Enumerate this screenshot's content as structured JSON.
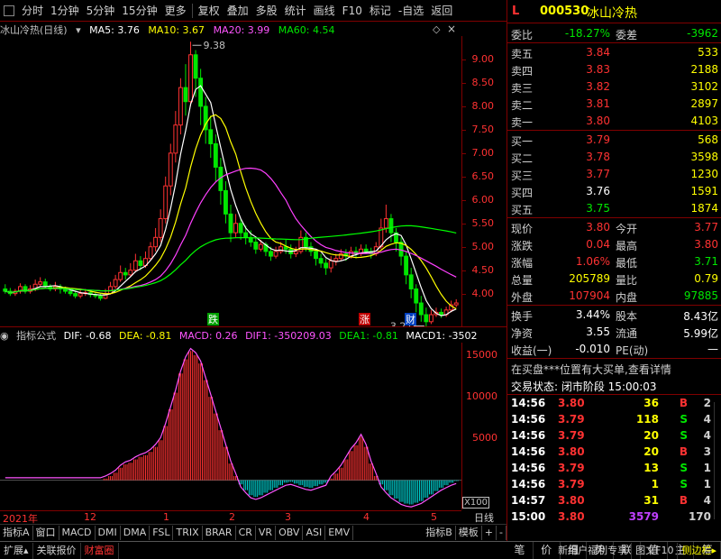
{
  "toolbar": {
    "items": [
      "分时",
      "1分钟",
      "5分钟",
      "15分钟",
      "更多",
      "复权",
      "叠加",
      "多股",
      "统计",
      "画线",
      "F10",
      "标记",
      "-自选",
      "返回"
    ]
  },
  "kline": {
    "title": "冰山冷热(日线)",
    "ma5": "MA5: 3.76",
    "ma10": "MA10: 3.67",
    "ma20": "MA20: 3.99",
    "ma60": "MA60: 4.54",
    "high_mark": "9.38",
    "low_mark": "3.27",
    "badges": [
      "跌",
      "涨",
      "财"
    ]
  },
  "macd": {
    "title": "指标公式",
    "dif": "DIF: -0.68",
    "dea": "DEA: -0.81",
    "macd": "MACD: 0.26",
    "dif1": "DIF1: -350209.03",
    "dea1": "DEA1: -0.81",
    "macd1": "MACD1: -3502",
    "scale_label": "X100"
  },
  "yaxis_main": [
    "9.00",
    "8.50",
    "8.00",
    "7.50",
    "7.00",
    "6.50",
    "6.00",
    "5.50",
    "5.00",
    "4.50",
    "4.00"
  ],
  "yaxis_macd": [
    "15000",
    "10000",
    "5000"
  ],
  "time_axis": [
    "2021年",
    "12",
    "1",
    "2",
    "3",
    "4",
    "5"
  ],
  "period": "日线",
  "indicator_tabs": [
    "指标A",
    "窗口",
    "MACD",
    "DMI",
    "DMA",
    "FSL",
    "TRIX",
    "BRAR",
    "CR",
    "VR",
    "OBV",
    "ASI",
    "EMV",
    "",
    "指标B",
    "模板",
    "+",
    "-"
  ],
  "statusbar": {
    "left": [
      "扩展",
      "关联报价",
      "财富圈"
    ],
    "right": [
      "新用户福利专享",
      "图文F10",
      "侧边栏"
    ]
  },
  "quote": {
    "market": "L",
    "code": "000530",
    "name": "冰山冷热",
    "weibi_label": "委比",
    "weibi": "-18.27%",
    "weicha_label": "委差",
    "weicha": "-3962",
    "asks": [
      {
        "label": "卖五",
        "price": "3.84",
        "vol": "533"
      },
      {
        "label": "卖四",
        "price": "3.83",
        "vol": "2188"
      },
      {
        "label": "卖三",
        "price": "3.82",
        "vol": "3102"
      },
      {
        "label": "卖二",
        "price": "3.81",
        "vol": "2897"
      },
      {
        "label": "卖一",
        "price": "3.80",
        "vol": "4103"
      }
    ],
    "bids": [
      {
        "label": "买一",
        "price": "3.79",
        "vol": "568"
      },
      {
        "label": "买二",
        "price": "3.78",
        "vol": "3598"
      },
      {
        "label": "买三",
        "price": "3.77",
        "vol": "1230"
      },
      {
        "label": "买四",
        "price": "3.76",
        "vol": "1591"
      },
      {
        "label": "买五",
        "price": "3.75",
        "vol": "1874"
      }
    ],
    "stats": [
      {
        "l1": "现价",
        "v1": "3.80",
        "l2": "今开",
        "v2": "3.77"
      },
      {
        "l1": "涨跌",
        "v1": "0.04",
        "l2": "最高",
        "v2": "3.80"
      },
      {
        "l1": "涨幅",
        "v1": "1.06%",
        "l2": "最低",
        "v2": "3.71"
      },
      {
        "l1": "总量",
        "v1": "205789",
        "l2": "量比",
        "v2": "0.79"
      },
      {
        "l1": "外盘",
        "v1": "107904",
        "l2": "内盘",
        "v2": "97885"
      }
    ],
    "stats2": [
      {
        "l1": "换手",
        "v1": "3.44%",
        "l2": "股本",
        "v2": "8.43亿"
      },
      {
        "l1": "净资",
        "v1": "3.55",
        "l2": "流通",
        "v2": "5.99亿"
      },
      {
        "l1": "收益(一)",
        "v1": "-0.010",
        "l2": "PE(动)",
        "v2": "—"
      }
    ],
    "notice": "在买盘***位置有大买单,查看详情",
    "trade_status": "交易状态: 闭市阶段 15:00:03",
    "ticks": [
      {
        "t": "14:56",
        "p": "3.80",
        "v": "36",
        "d": "B",
        "n": "2"
      },
      {
        "t": "14:56",
        "p": "3.79",
        "v": "118",
        "d": "S",
        "n": "4"
      },
      {
        "t": "14:56",
        "p": "3.79",
        "v": "20",
        "d": "S",
        "n": "4"
      },
      {
        "t": "14:56",
        "p": "3.80",
        "v": "20",
        "d": "B",
        "n": "3"
      },
      {
        "t": "14:56",
        "p": "3.79",
        "v": "13",
        "d": "S",
        "n": "1"
      },
      {
        "t": "14:56",
        "p": "3.79",
        "v": "1",
        "d": "S",
        "n": "1"
      },
      {
        "t": "14:57",
        "p": "3.80",
        "v": "31",
        "d": "B",
        "n": "4"
      },
      {
        "t": "15:00",
        "p": "3.80",
        "v": "3579",
        "d": "",
        "n": "170"
      }
    ],
    "bottom_tabs": [
      "笔",
      "价",
      "细",
      "势",
      "联",
      "值",
      "主",
      "筹"
    ]
  },
  "colors": {
    "up": "#ff3232",
    "down": "#00e600",
    "bg": "#000000",
    "ma5": "#ffffff",
    "ma10": "#ffff00",
    "ma20": "#ff40ff",
    "ma60": "#00ff00",
    "frame": "#800000"
  },
  "chart_data": {
    "type": "candlestick",
    "price_range": [
      3.3,
      9.5
    ],
    "candles": [
      [
        4.1,
        4.05,
        4.2,
        4.0
      ],
      [
        4.05,
        4.0,
        4.12,
        3.95
      ],
      [
        4.0,
        4.05,
        4.1,
        3.95
      ],
      [
        4.05,
        4.15,
        4.22,
        4.0
      ],
      [
        4.15,
        4.05,
        4.2,
        4.0
      ],
      [
        4.05,
        4.1,
        4.18,
        4.0
      ],
      [
        4.1,
        4.2,
        4.3,
        4.05
      ],
      [
        4.2,
        4.25,
        4.35,
        4.15
      ],
      [
        4.25,
        4.15,
        4.32,
        4.1
      ],
      [
        4.15,
        4.1,
        4.2,
        4.05
      ],
      [
        4.1,
        4.15,
        4.25,
        4.05
      ],
      [
        4.15,
        4.1,
        4.2,
        4.0
      ],
      [
        4.1,
        4.05,
        4.15,
        4.0
      ],
      [
        4.05,
        4.0,
        4.1,
        3.95
      ],
      [
        4.0,
        3.95,
        4.05,
        3.9
      ],
      [
        3.95,
        4.0,
        4.08,
        3.9
      ],
      [
        4.0,
        4.02,
        4.1,
        3.95
      ],
      [
        4.02,
        3.98,
        4.08,
        3.92
      ],
      [
        3.98,
        3.95,
        4.03,
        3.9
      ],
      [
        3.95,
        3.9,
        4.0,
        3.85
      ],
      [
        3.9,
        4.0,
        4.1,
        3.88
      ],
      [
        4.0,
        4.15,
        4.25,
        3.98
      ],
      [
        4.15,
        4.3,
        4.4,
        4.1
      ],
      [
        4.3,
        4.45,
        4.6,
        4.25
      ],
      [
        4.45,
        4.4,
        4.55,
        4.3
      ],
      [
        4.4,
        4.5,
        4.65,
        4.35
      ],
      [
        4.5,
        4.7,
        4.85,
        4.45
      ],
      [
        4.7,
        4.6,
        4.8,
        4.5
      ],
      [
        4.6,
        4.75,
        4.9,
        4.55
      ],
      [
        4.75,
        5.0,
        5.1,
        4.7
      ],
      [
        5.0,
        5.2,
        5.4,
        4.9
      ],
      [
        5.2,
        5.6,
        5.8,
        5.1
      ],
      [
        5.6,
        6.3,
        6.5,
        5.5
      ],
      [
        6.3,
        7.0,
        7.2,
        6.1
      ],
      [
        7.0,
        7.6,
        7.9,
        6.8
      ],
      [
        7.6,
        8.4,
        8.6,
        7.4
      ],
      [
        8.4,
        8.1,
        8.9,
        7.8
      ],
      [
        8.1,
        9.1,
        9.38,
        8.0
      ],
      [
        9.1,
        8.6,
        9.2,
        8.2
      ],
      [
        8.6,
        8.0,
        8.8,
        7.6
      ],
      [
        8.0,
        7.5,
        8.2,
        7.2
      ],
      [
        7.5,
        7.2,
        7.8,
        6.9
      ],
      [
        7.2,
        6.7,
        7.4,
        6.4
      ],
      [
        6.7,
        6.2,
        6.9,
        5.9
      ],
      [
        6.2,
        5.7,
        6.4,
        5.5
      ],
      [
        5.7,
        5.3,
        5.9,
        5.1
      ],
      [
        5.3,
        5.5,
        5.7,
        5.2
      ],
      [
        5.5,
        5.3,
        5.6,
        5.15
      ],
      [
        5.3,
        5.2,
        5.45,
        5.05
      ],
      [
        5.2,
        5.1,
        5.35,
        5.0
      ],
      [
        5.1,
        4.95,
        5.2,
        4.85
      ],
      [
        4.95,
        5.05,
        5.15,
        4.9
      ],
      [
        5.05,
        4.9,
        5.1,
        4.8
      ],
      [
        4.9,
        4.8,
        5.0,
        4.7
      ],
      [
        4.8,
        4.9,
        5.0,
        4.75
      ],
      [
        4.9,
        5.0,
        5.1,
        4.85
      ],
      [
        5.0,
        4.95,
        5.15,
        4.85
      ],
      [
        4.95,
        4.85,
        5.05,
        4.75
      ],
      [
        4.85,
        4.9,
        5.0,
        4.78
      ],
      [
        4.9,
        5.2,
        5.35,
        4.85
      ],
      [
        5.2,
        5.0,
        5.3,
        4.9
      ],
      [
        5.0,
        4.9,
        5.1,
        4.8
      ],
      [
        4.9,
        4.75,
        4.95,
        4.6
      ],
      [
        4.75,
        4.65,
        4.85,
        4.55
      ],
      [
        4.65,
        4.55,
        4.75,
        4.4
      ],
      [
        4.55,
        4.7,
        4.8,
        4.45
      ],
      [
        4.7,
        4.75,
        4.85,
        4.6
      ],
      [
        4.75,
        4.85,
        4.95,
        4.7
      ],
      [
        4.85,
        4.8,
        4.95,
        4.7
      ],
      [
        4.8,
        4.9,
        5.0,
        4.75
      ],
      [
        4.9,
        4.85,
        5.0,
        4.75
      ],
      [
        4.85,
        4.95,
        5.05,
        4.8
      ],
      [
        4.95,
        4.9,
        5.05,
        4.85
      ],
      [
        4.9,
        4.85,
        4.98,
        4.75
      ],
      [
        4.85,
        5.0,
        5.1,
        4.8
      ],
      [
        5.0,
        5.4,
        5.6,
        4.95
      ],
      [
        5.4,
        5.6,
        5.9,
        5.3
      ],
      [
        5.6,
        5.3,
        5.7,
        5.1
      ],
      [
        5.3,
        5.1,
        5.4,
        4.9
      ],
      [
        5.1,
        4.8,
        5.2,
        4.6
      ],
      [
        4.8,
        4.4,
        4.9,
        4.2
      ],
      [
        4.4,
        4.1,
        4.55,
        3.9
      ],
      [
        4.1,
        3.8,
        4.2,
        3.6
      ],
      [
        3.8,
        3.55,
        3.95,
        3.4
      ],
      [
        3.55,
        3.4,
        3.7,
        3.27
      ],
      [
        3.4,
        3.55,
        3.65,
        3.35
      ],
      [
        3.55,
        3.6,
        3.7,
        3.5
      ],
      [
        3.6,
        3.55,
        3.68,
        3.48
      ],
      [
        3.55,
        3.65,
        3.72,
        3.5
      ],
      [
        3.65,
        3.76,
        3.85,
        3.6
      ],
      [
        3.76,
        3.8,
        3.88,
        3.71
      ]
    ],
    "macd_range": [
      -3500,
      16500
    ],
    "macd_values": [
      0,
      0,
      0,
      0,
      0,
      0,
      0,
      0,
      0,
      0,
      0,
      0,
      0,
      0,
      0,
      0,
      0,
      0,
      0,
      0,
      200,
      500,
      900,
      1500,
      1900,
      2100,
      2500,
      2800,
      3000,
      3400,
      4000,
      4800,
      6500,
      8500,
      10500,
      12800,
      14500,
      15500,
      15000,
      14000,
      12000,
      10000,
      8000,
      6000,
      4000,
      2000,
      500,
      -500,
      -1200,
      -1800,
      -2000,
      -1800,
      -1500,
      -1200,
      -900,
      -600,
      -300,
      -200,
      -400,
      -600,
      -800,
      -900,
      -700,
      -500,
      -300,
      200,
      800,
      1500,
      2500,
      3500,
      4200,
      5200,
      4000,
      2000,
      500,
      -500,
      -1200,
      -1800,
      -2200,
      -2600,
      -2800,
      -2900,
      -2700,
      -2500,
      -2100,
      -1700,
      -1300,
      -900,
      -600,
      -300,
      -100
    ]
  }
}
